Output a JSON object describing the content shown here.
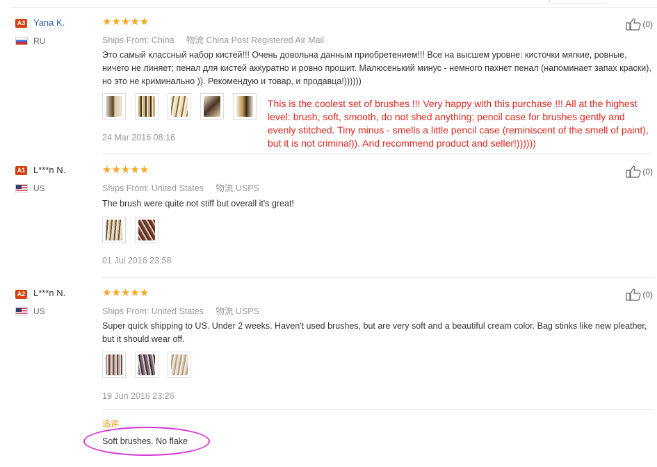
{
  "reviews": [
    {
      "badge": "A3",
      "username": "Yana K.",
      "country": "RU",
      "flag": "russia-flag-icon",
      "stars": "★★★★★",
      "ships_from_label": "Ships From:",
      "ships_from": "China",
      "method_label": "物流",
      "method": "China Post Registered Air Mail",
      "text": "Это самый классный набор кистей!!! Очень довольна данным приобретением!!! Все на высшем уровне: кисточки мягкие, ровные, ничего не линяет; пенал для кистей аккуратно и ровно прошит. Малюсенький минус - немного пахнет пенал (напоминает запах краски), но это не криминально )). Рекомендую и товар, и продавца!))))))",
      "date": "24 Mar 2016 08:16",
      "likes": "(0)"
    },
    {
      "badge": "A1",
      "username": "L***n N.",
      "country": "US",
      "flag": "usa-flag-icon",
      "stars": "★★★★★",
      "ships_from_label": "Ships From:",
      "ships_from": "United States",
      "method_label": "物流",
      "method": "USPS",
      "text": "The brush were quite not stiff but overall it's great!",
      "date": "01 Jul 2016 23:58",
      "likes": "(0)"
    },
    {
      "badge": "A2",
      "username": "L***n N.",
      "country": "US",
      "flag": "usa-flag-icon",
      "stars": "★★★★★",
      "ships_from_label": "Ships From:",
      "ships_from": "United States",
      "method_label": "物流",
      "method": "USPS",
      "text": "Super quick shipping to US. Under 2 weeks. Haven't used brushes, but are very soft and a beautiful cream color. Bag stinks like new pleather, but it should wear off.",
      "date": "19 Jun 2016 23:26",
      "likes": "(0)",
      "followup_label": "追评",
      "followup_text": "Soft brushes. No flake"
    }
  ],
  "translation": "This is the coolest set of brushes !!! Very happy with this purchase !!! All at the highest level: brush, soft, smooth, do not shed anything; pencil case for brushes gently and evenly stitched. Tiny minus - smells a little pencil case (reminiscent of the smell of paint), but it is not criminal)). And recommend product and seller!))))))",
  "colors": {
    "star": "#f5a623",
    "badge": "#d5400f",
    "username_link": "#2a5ea8",
    "translation": "#d9261c",
    "followup_label": "#f29100",
    "highlight_oval": "#d633d6"
  }
}
